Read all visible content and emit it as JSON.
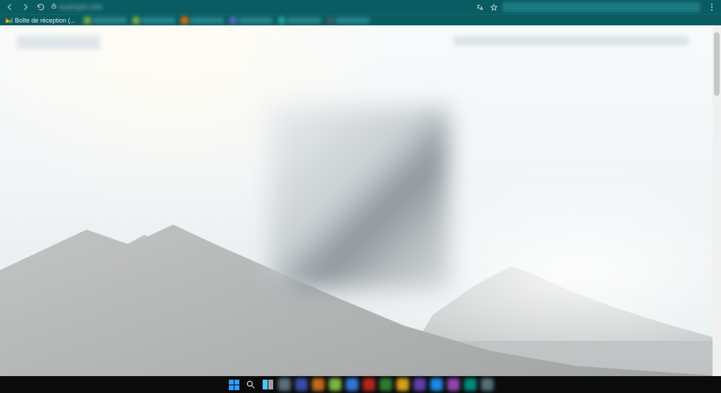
{
  "browser": {
    "address_text": "example.site",
    "tab": {
      "title": "Boîte de réception (..."
    },
    "bookmarks": [
      {
        "color": "#7cb342"
      },
      {
        "color": "#7cb342"
      },
      {
        "color": "#ef6c00"
      },
      {
        "color": "#5c6bc0"
      },
      {
        "color": "#26a69a"
      },
      {
        "color": "#455a64"
      }
    ]
  },
  "taskbar": {
    "apps": [
      {
        "name": "app-1",
        "color": "#5b6e7a"
      },
      {
        "name": "app-2",
        "color": "#3a4aa8"
      },
      {
        "name": "app-3",
        "color": "#c26a1b"
      },
      {
        "name": "app-4",
        "color": "#7cb342"
      },
      {
        "name": "app-5",
        "color": "#3077d6"
      },
      {
        "name": "app-6",
        "color": "#b3261e"
      },
      {
        "name": "app-7",
        "color": "#2e7d32"
      },
      {
        "name": "app-8",
        "color": "#d4a017"
      },
      {
        "name": "app-9",
        "color": "#5b3fa8"
      },
      {
        "name": "app-10",
        "color": "#1e88e5"
      },
      {
        "name": "app-11",
        "color": "#8e44ad"
      },
      {
        "name": "app-12",
        "color": "#00897b"
      },
      {
        "name": "app-13",
        "color": "#546e7a"
      }
    ]
  }
}
